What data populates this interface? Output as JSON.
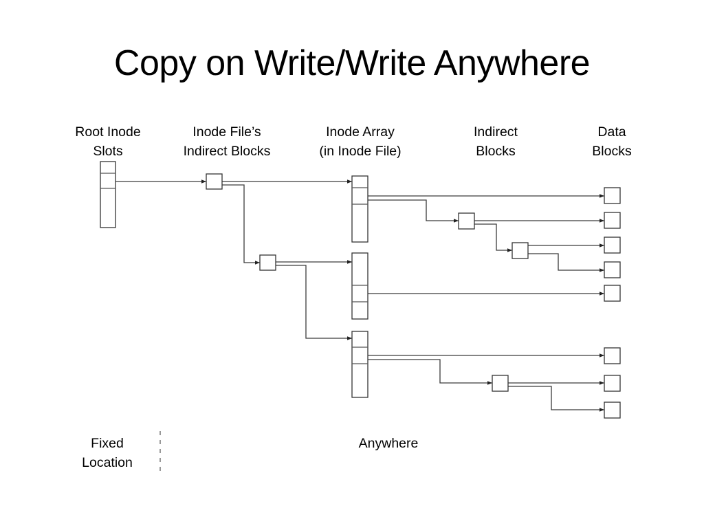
{
  "slide": {
    "title": "Copy on Write/Write Anywhere"
  },
  "columns": [
    {
      "id": "root",
      "lines": [
        "Root Inode",
        "Slots"
      ]
    },
    {
      "id": "inode-file-indirect",
      "lines": [
        "Inode File’s",
        "Indirect Blocks"
      ]
    },
    {
      "id": "inode-array",
      "lines": [
        "Inode Array",
        "(in Inode File)"
      ]
    },
    {
      "id": "indirect",
      "lines": [
        "Indirect",
        "Blocks"
      ]
    },
    {
      "id": "data",
      "lines": [
        "Data",
        "Blocks"
      ]
    }
  ],
  "regions": {
    "fixed": [
      "Fixed",
      "Location"
    ],
    "anywhere": [
      "Anywhere"
    ]
  },
  "diagram": {
    "nodes": [
      {
        "id": "root-slots",
        "kind": "array",
        "cells": 3,
        "column": "root"
      },
      {
        "id": "ifi-1",
        "kind": "block",
        "column": "inode-file-indirect"
      },
      {
        "id": "ifi-2",
        "kind": "block",
        "column": "inode-file-indirect"
      },
      {
        "id": "ia-1",
        "kind": "array",
        "cells": 3,
        "column": "inode-array"
      },
      {
        "id": "ia-2",
        "kind": "array",
        "cells": 3,
        "column": "inode-array"
      },
      {
        "id": "ia-3",
        "kind": "array",
        "cells": 3,
        "column": "inode-array"
      },
      {
        "id": "ind-1",
        "kind": "block",
        "column": "indirect"
      },
      {
        "id": "ind-2",
        "kind": "block",
        "column": "indirect"
      },
      {
        "id": "ind-3",
        "kind": "block",
        "column": "indirect"
      },
      {
        "id": "d-1",
        "kind": "block",
        "column": "data"
      },
      {
        "id": "d-2",
        "kind": "block",
        "column": "data"
      },
      {
        "id": "d-3",
        "kind": "block",
        "column": "data"
      },
      {
        "id": "d-4",
        "kind": "block",
        "column": "data"
      },
      {
        "id": "d-5",
        "kind": "block",
        "column": "data"
      },
      {
        "id": "d-6",
        "kind": "block",
        "column": "data"
      },
      {
        "id": "d-7",
        "kind": "block",
        "column": "data"
      },
      {
        "id": "d-8",
        "kind": "block",
        "column": "data"
      }
    ],
    "edges": [
      {
        "from": "root-slots",
        "to": "ifi-1"
      },
      {
        "from": "ifi-1",
        "to": "ia-1"
      },
      {
        "from": "ifi-1",
        "to": "ifi-2"
      },
      {
        "from": "ifi-2",
        "to": "ia-2"
      },
      {
        "from": "ifi-2",
        "to": "ia-3"
      },
      {
        "from": "ia-1",
        "to": "d-1"
      },
      {
        "from": "ia-1",
        "to": "ind-1"
      },
      {
        "from": "ind-1",
        "to": "d-2"
      },
      {
        "from": "ind-1",
        "to": "ind-2"
      },
      {
        "from": "ind-2",
        "to": "d-3"
      },
      {
        "from": "ind-2",
        "to": "d-4"
      },
      {
        "from": "ia-2",
        "to": "d-5"
      },
      {
        "from": "ia-3",
        "to": "d-6"
      },
      {
        "from": "ia-3",
        "to": "ind-3"
      },
      {
        "from": "ind-3",
        "to": "d-7"
      },
      {
        "from": "ind-3",
        "to": "d-8"
      }
    ]
  }
}
